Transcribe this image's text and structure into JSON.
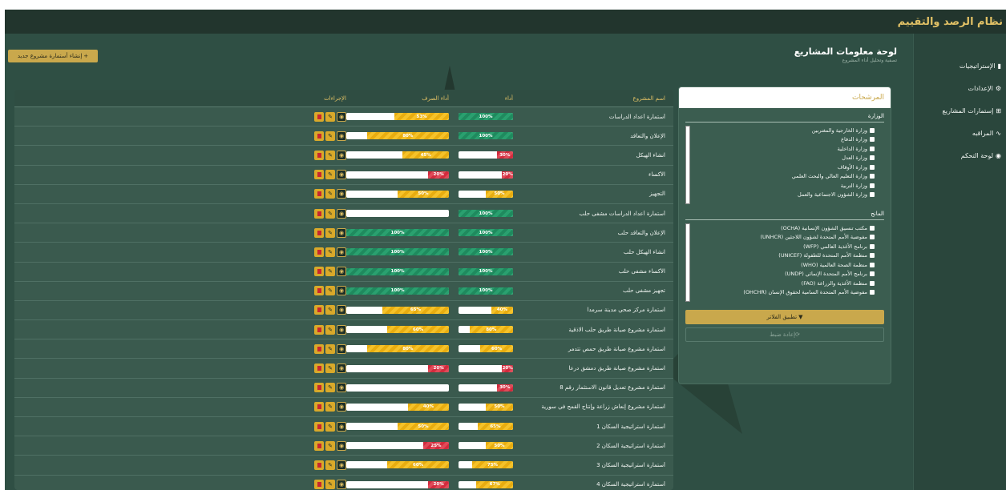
{
  "app": {
    "title": "نظام الرصد والتقييم"
  },
  "sidebar": {
    "items": [
      {
        "label": "الإستراتيجيات",
        "icon": "bar-chart-icon"
      },
      {
        "label": "الإعدادات",
        "icon": "gears-icon"
      },
      {
        "label": "إستمارات المشاريع",
        "icon": "sitemap-icon"
      },
      {
        "label": "المراقبه",
        "icon": "line-chart-icon"
      },
      {
        "label": "لوحة التحكم",
        "icon": "dashboard-icon"
      }
    ]
  },
  "header": {
    "title": "لوحة معلومات المشاريع",
    "subtitle": "تصفية وتحليل أداء المشروع",
    "new_button": "إنشاء أستمارة مشروع جديد"
  },
  "filters": {
    "title": "المرشحات",
    "ministry_label": "الوزارة",
    "ministries": [
      "وزارة الخارجية والمغتربين",
      "وزارة الدفاع",
      "وزارة الداخلية",
      "وزارة العدل",
      "وزارة الأوقاف",
      "وزارة التعليم العالي والبحث العلمي",
      "وزارة التربية",
      "وزارة الشؤون الاجتماعية والعمل"
    ],
    "donor_label": "المانح",
    "donors": [
      "مكتب تنسيق الشؤون الإنسانية (OCHA)",
      "مفوضية الأمم المتحدة لشؤون اللاجئين (UNHCR)",
      "برنامج الأغذية العالمي (WFP)",
      "منظمة الأمم المتحدة للطفولة (UNICEF)",
      "منظمة الصحة العالمية (WHO)",
      "برنامج الأمم المتحدة الإنمائي (UNDP)",
      "منظمة الأغذية والزراعة (FAO)",
      "مفوضية الأمم المتحدة السامية لحقوق الإنسان (OHCHR)"
    ],
    "apply_label": "تطبيق الفلاتر",
    "reset_label": "إعادة ضبط"
  },
  "table": {
    "headers": {
      "name": "اسم المشروع",
      "performance": "أداء",
      "spending": "أداء الصرف",
      "actions": "الإجراءات"
    },
    "rows": [
      {
        "name": "أستمارة أعداد الدراسات",
        "perf": 100,
        "perf_label": "100%",
        "perf_color": "green",
        "spend": 53,
        "spend_label": "53%",
        "spend_color": "yellow"
      },
      {
        "name": "الإعلان والتعاقد",
        "perf": 100,
        "perf_label": "100%",
        "perf_color": "green",
        "spend": 80,
        "spend_label": "80%",
        "spend_color": "yellow"
      },
      {
        "name": "انشاء الهيكل",
        "perf": 30,
        "perf_label": "30%",
        "perf_color": "red",
        "spend": 45,
        "spend_label": "45%",
        "spend_color": "yellow"
      },
      {
        "name": "الأكساء",
        "perf": 20,
        "perf_label": "20%",
        "perf_color": "red",
        "spend": 20,
        "spend_label": "20%",
        "spend_color": "red"
      },
      {
        "name": "التجهيز",
        "perf": 50,
        "perf_label": "50%",
        "perf_color": "yellow",
        "spend": 50,
        "spend_label": "50%",
        "spend_color": "yellow"
      },
      {
        "name": "أستمارة أعداد الدراسات مشفى حلب",
        "perf": 100,
        "perf_label": "100%",
        "perf_color": "green",
        "spend": 0,
        "spend_label": "",
        "spend_color": "yellow"
      },
      {
        "name": "الإعلان والتعاقد حلب",
        "perf": 100,
        "perf_label": "100%",
        "perf_color": "green",
        "spend": 100,
        "spend_label": "100%",
        "spend_color": "green"
      },
      {
        "name": "انشاء الهيكل حلب",
        "perf": 100,
        "perf_label": "100%",
        "perf_color": "green",
        "spend": 100,
        "spend_label": "100%",
        "spend_color": "green"
      },
      {
        "name": "الأكساء مشفى حلب",
        "perf": 100,
        "perf_label": "100%",
        "perf_color": "green",
        "spend": 100,
        "spend_label": "100%",
        "spend_color": "green"
      },
      {
        "name": "تجهيز مشفى حلب",
        "perf": 100,
        "perf_label": "100%",
        "perf_color": "green",
        "spend": 100,
        "spend_label": "100%",
        "spend_color": "green"
      },
      {
        "name": "استمارة مركز صحي مدينة سرمدا",
        "perf": 40,
        "perf_label": "40%",
        "perf_color": "yellow",
        "spend": 65,
        "spend_label": "65%",
        "spend_color": "yellow"
      },
      {
        "name": "استمارة مشروع صيانة طريق حلب الاذقية",
        "perf": 80,
        "perf_label": "80%",
        "perf_color": "yellow",
        "spend": 60,
        "spend_label": "60%",
        "spend_color": "yellow"
      },
      {
        "name": "استمارة مشروع صيانة طريق حمص تتدمر",
        "perf": 60,
        "perf_label": "60%",
        "perf_color": "yellow",
        "spend": 80,
        "spend_label": "80%",
        "spend_color": "yellow"
      },
      {
        "name": "استمارة مشروع صيانة طريق دمشق درعا",
        "perf": 20,
        "perf_label": "20%",
        "perf_color": "red",
        "spend": 20,
        "spend_label": "20%",
        "spend_color": "red"
      },
      {
        "name": "استمارة مشروع تعديل قانون الاستثمار رقم 8",
        "perf": 30,
        "perf_label": "30%",
        "perf_color": "red",
        "spend": 0,
        "spend_label": "",
        "spend_color": "yellow"
      },
      {
        "name": "استمارة مشروع إنعاش زراعة وإنتاج القمح في سورية",
        "perf": 50,
        "perf_label": "50%",
        "perf_color": "yellow",
        "spend": 40,
        "spend_label": "40%",
        "spend_color": "yellow"
      },
      {
        "name": "أستمارة استراتيجية السكان 1",
        "perf": 65,
        "perf_label": "65%",
        "perf_color": "yellow",
        "spend": 50,
        "spend_label": "50%",
        "spend_color": "yellow"
      },
      {
        "name": "أستمارة استراتيجية السكان 2",
        "perf": 50,
        "perf_label": "50%",
        "perf_color": "yellow",
        "spend": 25,
        "spend_label": "25%",
        "spend_color": "red"
      },
      {
        "name": "أستمارة استراتيجية السكان 3",
        "perf": 75,
        "perf_label": "75%",
        "perf_color": "yellow",
        "spend": 60,
        "spend_label": "60%",
        "spend_color": "yellow"
      },
      {
        "name": "أستمارة استراتيجية السكان 4",
        "perf": 67,
        "perf_label": "67%",
        "perf_color": "yellow",
        "spend": 20,
        "spend_label": "20%",
        "spend_color": "red"
      }
    ]
  }
}
